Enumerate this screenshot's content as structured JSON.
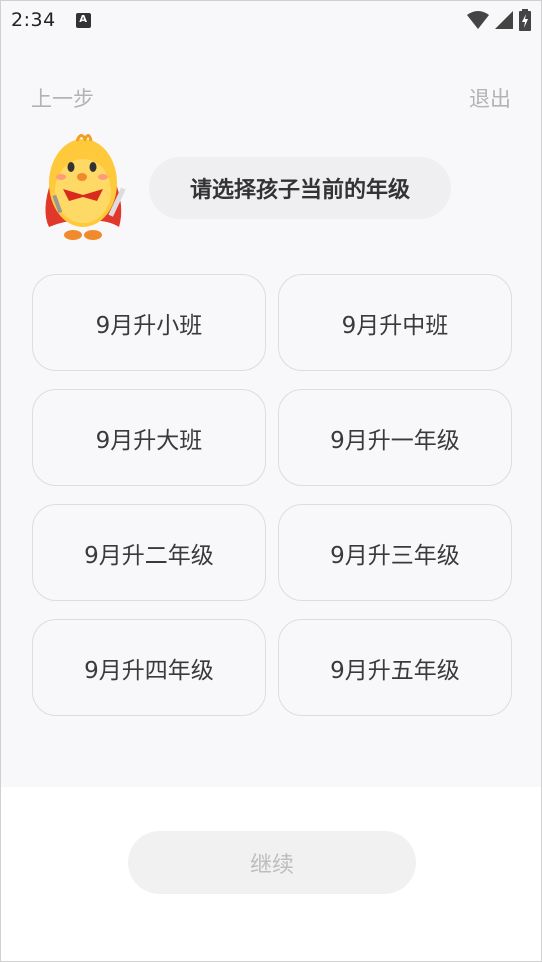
{
  "status_bar": {
    "time": "2:34",
    "notification_badge": "A",
    "icons": [
      "wifi-icon",
      "signal-icon",
      "battery-icon"
    ]
  },
  "nav": {
    "back_label": "上一步",
    "exit_label": "退出"
  },
  "prompt": {
    "mascot_icon": "chick-mascot-icon",
    "text": "请选择孩子当前的年级"
  },
  "grades": [
    {
      "label": "9月升小班"
    },
    {
      "label": "9月升中班"
    },
    {
      "label": "9月升大班"
    },
    {
      "label": "9月升一年级"
    },
    {
      "label": "9月升二年级"
    },
    {
      "label": "9月升三年级"
    },
    {
      "label": "9月升四年级"
    },
    {
      "label": "9月升五年级"
    }
  ],
  "footer": {
    "continue_label": "继续"
  },
  "colors": {
    "background": "#f8f8fb",
    "muted_text": "#b3b3b3",
    "option_border": "#dcdce2",
    "button_disabled": "#f1f1f2"
  }
}
